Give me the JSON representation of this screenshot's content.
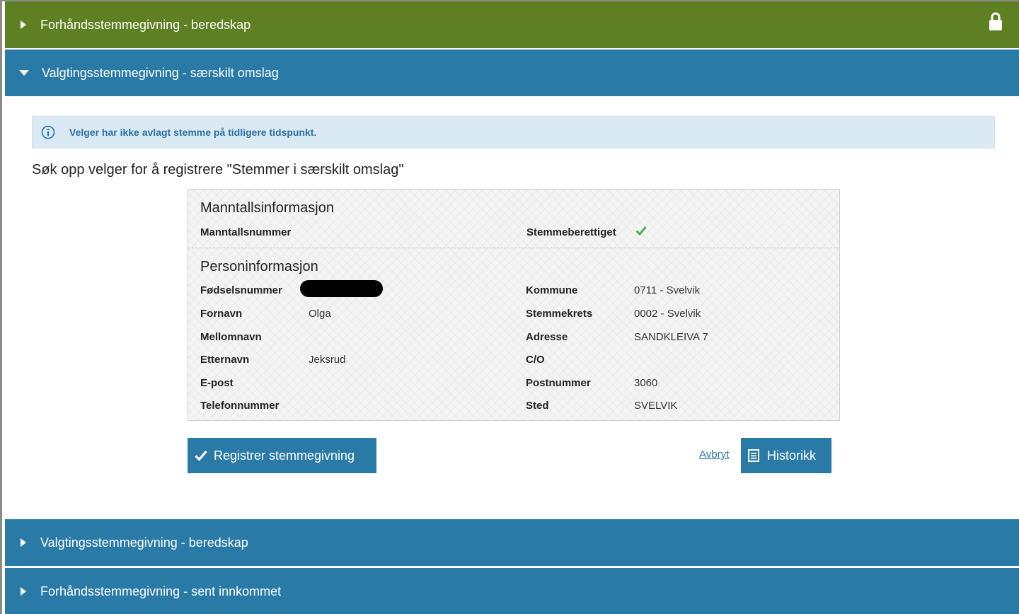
{
  "panels": {
    "advance_preparedness": {
      "title": "Forhåndsstemmegivning - beredskap"
    },
    "election_day_separate": {
      "title": "Valgtingsstemmegivning - særskilt omslag"
    },
    "election_day_preparedness": {
      "title": "Valgtingsstemmegivning - beredskap"
    },
    "advance_late": {
      "title": "Forhåndsstemmegivning - sent innkommet"
    }
  },
  "alert": {
    "text": "Velger har ikke avlagt stemme på tidligere tidspunkt."
  },
  "search_heading": "Søk opp velger for å registrere \"Stemmer i særskilt omslag\"",
  "registry": {
    "title": "Manntallsinformasjon",
    "fields": {
      "registry_number_label": "Manntallsnummer",
      "registry_number_value": "",
      "eligible_label": "Stemmeberettiget"
    }
  },
  "person": {
    "title": "Personinformasjon",
    "left": {
      "birth_number_label": "Fødselsnummer",
      "first_name_label": "Fornavn",
      "first_name_value": "Olga",
      "middle_name_label": "Mellomnavn",
      "middle_name_value": "",
      "last_name_label": "Etternavn",
      "last_name_value": "Jeksrud",
      "email_label": "E-post",
      "email_value": "",
      "phone_label": "Telefonnummer",
      "phone_value": ""
    },
    "right": {
      "municipality_label": "Kommune",
      "municipality_value": "0711 - Svelvik",
      "district_label": "Stemmekrets",
      "district_value": "0002 - Svelvik",
      "address_label": "Adresse",
      "address_value": "SANDKLEIVA 7",
      "co_label": "C/O",
      "co_value": "",
      "postal_code_label": "Postnummer",
      "postal_code_value": "3060",
      "place_label": "Sted",
      "place_value": "SVELVIK"
    }
  },
  "actions": {
    "register_label": "Registrer stemmegivning",
    "cancel_label": "Avbryt",
    "history_label": "Historikk"
  },
  "colors": {
    "green_header": "#5e8023",
    "blue_header": "#2a7aa7",
    "alert_bg": "#d9eaf5",
    "check_green": "#4caf50"
  }
}
